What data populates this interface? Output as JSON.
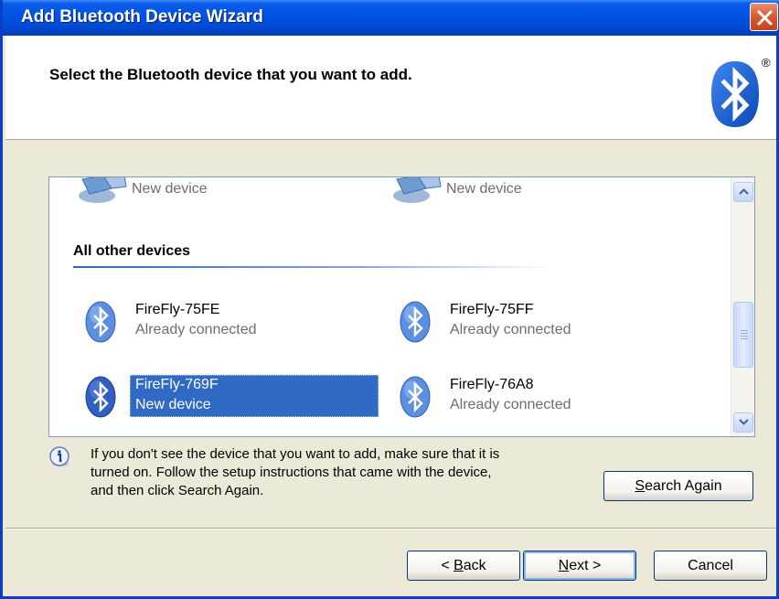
{
  "window": {
    "title": "Add Bluetooth Device Wizard"
  },
  "header": {
    "heading": "Select the Bluetooth device that you want to add.",
    "trademark": "®"
  },
  "device_list": {
    "top_items": [
      {
        "label": "New device"
      },
      {
        "label": "New device"
      }
    ],
    "group_header": "All other devices",
    "devices": [
      {
        "name": "FireFly-75FE",
        "status": "Already connected",
        "selected": false
      },
      {
        "name": "FireFly-75FF",
        "status": "Already connected",
        "selected": false
      },
      {
        "name": "FireFly-769F",
        "status": "New device",
        "selected": true
      },
      {
        "name": "FireFly-76A8",
        "status": "Already connected",
        "selected": false
      }
    ]
  },
  "info": {
    "message_line1": "If you don't see the device that you want to add, make sure that it is",
    "message_line2": "turned on. Follow the setup instructions that came with the device,",
    "message_line3": "and then click Search Again."
  },
  "buttons": {
    "search_again": {
      "accel": "S",
      "rest": "earch Again"
    },
    "back": {
      "prefix": "< ",
      "accel": "B",
      "rest": "ack"
    },
    "next": {
      "accel": "N",
      "rest": "ext >"
    },
    "cancel": "Cancel"
  },
  "colors": {
    "titlebar": "#0054e3",
    "selection": "#316ac5",
    "bluetooth_blue": "#2f6fd8",
    "dialog_bg": "#ece9d8"
  }
}
